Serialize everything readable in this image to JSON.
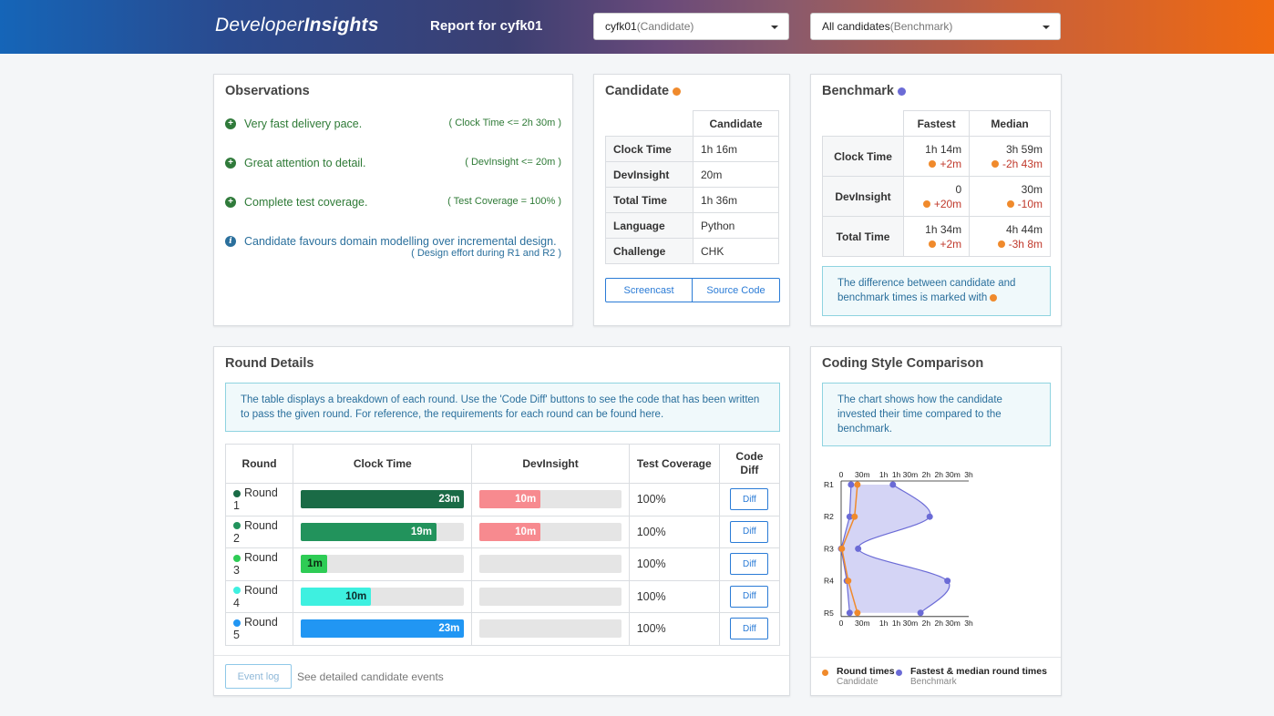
{
  "header": {
    "logo_part1": "Developer",
    "logo_part2": "Insights",
    "report_title": "Report for cyfk01",
    "candidate_select": {
      "value": "cyfk01",
      "suffix": "(Candidate)"
    },
    "benchmark_select": {
      "value": "All candidates",
      "suffix": "(Benchmark)"
    }
  },
  "observations": {
    "title": "Observations",
    "items": [
      {
        "icon": "plus-circle-icon",
        "text": "Very fast delivery pace.",
        "note": "( Clock Time <= 2h 30m )"
      },
      {
        "icon": "plus-circle-icon",
        "text": "Great attention to detail.",
        "note": "( DevInsight <= 20m )"
      },
      {
        "icon": "plus-circle-icon",
        "text": "Complete test coverage.",
        "note": "( Test Coverage = 100% )"
      },
      {
        "icon": "info-circle-icon",
        "text": "Candidate favours domain modelling over incremental design.",
        "note": "( Design effort during R1 and R2 )"
      }
    ]
  },
  "candidate": {
    "title": "Candidate",
    "column": "Candidate",
    "rows": [
      {
        "label": "Clock Time",
        "value": "1h 16m"
      },
      {
        "label": "DevInsight",
        "value": "20m"
      },
      {
        "label": "Total Time",
        "value": "1h 36m"
      },
      {
        "label": "Language",
        "value": "Python"
      },
      {
        "label": "Challenge",
        "value": "CHK"
      }
    ],
    "screencast_label": "Screencast",
    "source_label": "Source Code"
  },
  "benchmark": {
    "title": "Benchmark",
    "columns": [
      "Fastest",
      "Median"
    ],
    "rows": [
      {
        "label": "Clock Time",
        "fastest": "1h 14m",
        "fastest_diff": "+2m",
        "median": "3h 59m",
        "median_diff": "-2h 43m"
      },
      {
        "label": "DevInsight",
        "fastest": "0",
        "fastest_diff": "+20m",
        "median": "30m",
        "median_diff": "-10m"
      },
      {
        "label": "Total Time",
        "fastest": "1h 34m",
        "fastest_diff": "+2m",
        "median": "4h 44m",
        "median_diff": "-3h 8m"
      }
    ],
    "note": "The difference between candidate and benchmark times is marked with"
  },
  "rounds": {
    "title": "Round Details",
    "info_text": "The table displays a breakdown of each round. Use the 'Code Diff' buttons to see the code that has been written to pass the given round. For reference, the requirements for each round can be found",
    "info_link": "here",
    "columns": [
      "Round",
      "Clock Time",
      "DevInsight",
      "Test Coverage",
      "Code Diff"
    ],
    "rows": [
      {
        "name": "Round 1",
        "color": "#1a6b46",
        "clock": "23m",
        "clock_frac": 1.0,
        "clock_text": "#ffffff",
        "dev": "10m",
        "dev_frac": 0.43,
        "coverage": "100%",
        "diff": "Diff"
      },
      {
        "name": "Round 2",
        "color": "#22935c",
        "clock": "19m",
        "clock_frac": 0.83,
        "clock_text": "#ffffff",
        "dev": "10m",
        "dev_frac": 0.43,
        "coverage": "100%",
        "diff": "Diff"
      },
      {
        "name": "Round 3",
        "color": "#2ecc55",
        "clock": "1m",
        "clock_frac": 0.16,
        "clock_text": "#0d2a12",
        "dev": "",
        "dev_frac": 0,
        "coverage": "100%",
        "diff": "Diff"
      },
      {
        "name": "Round 4",
        "color": "#3ef0e0",
        "clock": "10m",
        "clock_frac": 0.43,
        "clock_text": "#0d2a2a",
        "dev": "",
        "dev_frac": 0,
        "coverage": "100%",
        "diff": "Diff"
      },
      {
        "name": "Round 5",
        "color": "#2196f3",
        "clock": "23m",
        "clock_frac": 1.0,
        "clock_text": "#ffffff",
        "dev": "",
        "dev_frac": 0,
        "coverage": "100%",
        "diff": "Diff"
      }
    ],
    "event_log_label": "Event log",
    "event_log_text": "See detailed candidate events",
    "dev_bar_color": "#f78a8f"
  },
  "coding_style": {
    "title": "Coding Style Comparison",
    "info_text": "The chart shows how the candidate invested their time compared to the benchmark.",
    "legend": [
      {
        "label": "Round times",
        "sub": "Candidate",
        "color": "#f08a2c"
      },
      {
        "label": "Fastest & median round times",
        "sub": "Benchmark",
        "color": "#6b6bd6"
      }
    ]
  },
  "chart_data": {
    "type": "line",
    "orientation": "horizontal",
    "x_unit": "minutes",
    "xlim": [
      0,
      180
    ],
    "x_ticks": [
      {
        "value": 0,
        "label": "0"
      },
      {
        "value": 30,
        "label": "30m"
      },
      {
        "value": 60,
        "label": "1h"
      },
      {
        "value": 90,
        "label": "1h 30m"
      },
      {
        "value": 120,
        "label": "2h"
      },
      {
        "value": 150,
        "label": "2h 30m"
      },
      {
        "value": 180,
        "label": "3h"
      }
    ],
    "categories": [
      "R1",
      "R2",
      "R3",
      "R4",
      "R5"
    ],
    "series": [
      {
        "name": "Candidate",
        "role": "candidate",
        "values": [
          23,
          19,
          1,
          10,
          23
        ]
      },
      {
        "name": "Fastest",
        "role": "benchmark_min",
        "values": [
          14,
          12,
          0,
          8,
          12
        ]
      },
      {
        "name": "Median",
        "role": "benchmark_max",
        "values": [
          73,
          125,
          24,
          150,
          112
        ]
      }
    ],
    "grid": false,
    "legend": "bottom"
  }
}
